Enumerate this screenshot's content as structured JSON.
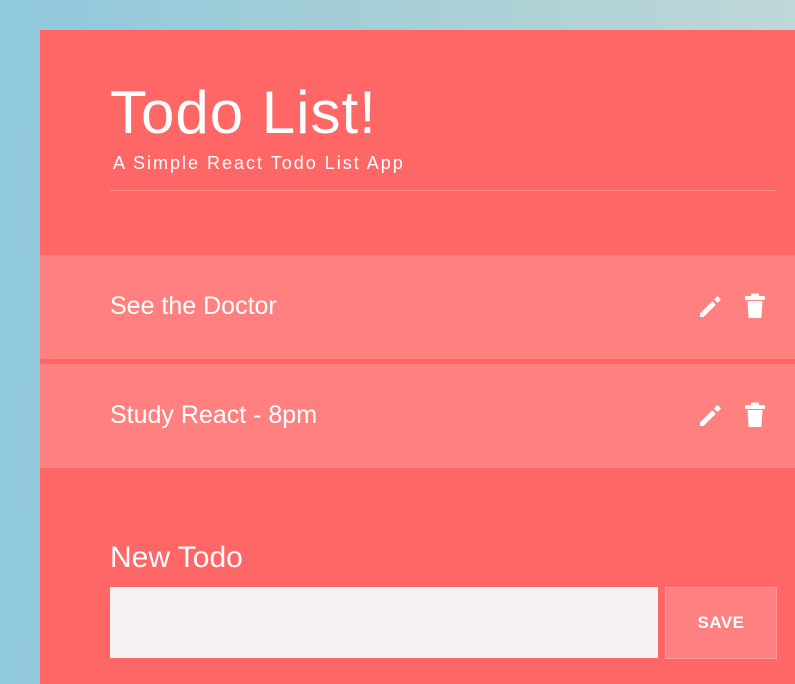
{
  "header": {
    "title": "Todo List!",
    "subtitle": "A Simple React Todo List App"
  },
  "todos": [
    {
      "text": "See the Doctor",
      "edit_icon": "pencil-icon",
      "delete_icon": "trash-icon"
    },
    {
      "text": "Study React - 8pm",
      "edit_icon": "pencil-icon",
      "delete_icon": "trash-icon"
    }
  ],
  "new_todo": {
    "label": "New Todo",
    "value": "",
    "placeholder": "",
    "save_label": "SAVE"
  },
  "colors": {
    "background_start": "#8fc8dc",
    "background_end": "#bfd7d7",
    "panel": "#ff6666",
    "todo_item": "#ff807f",
    "input_background": "#f6f0f0",
    "text": "#ffffff"
  }
}
